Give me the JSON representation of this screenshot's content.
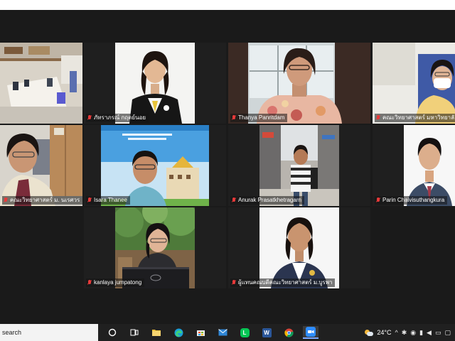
{
  "meeting": {
    "participants": [
      {
        "name": "",
        "tile": "conference-room"
      },
      {
        "name": "ภัทราภรณ์ กฤตย์นอย",
        "tile": "woman-white-bg"
      },
      {
        "name": "Thanya Panritdam",
        "tile": "woman-window"
      },
      {
        "name": "คณะวิทยาศาสตร์ มหาวิทยาลัยบูรพา",
        "tile": "woman-mask",
        "active": true
      },
      {
        "name": "คณะวิทยาศาสตร์ ม. นเรศวร",
        "tile": "man-office"
      },
      {
        "name": "Isara Thanee",
        "tile": "man-virtual-bg"
      },
      {
        "name": "Anurak Prasatkhetragarn",
        "tile": "man-street"
      },
      {
        "name": "Parin Chaivisuthangkura",
        "tile": "man-suit"
      },
      {
        "name": "kanlaya jumpatong",
        "tile": "woman-laptop"
      },
      {
        "name": "ผู้แทนคณบดีคณะวิทยาศาสตร์ ม.บูรพา",
        "tile": "woman-uniform"
      }
    ]
  },
  "taskbar": {
    "search_label": "search",
    "icons": [
      "cortana-icon",
      "task-view-icon",
      "file-explorer-icon",
      "edge-icon",
      "store-icon",
      "mail-icon",
      "line-icon",
      "word-icon",
      "chrome-icon",
      "zoom-icon"
    ],
    "word_letter": "W",
    "line_letter": "L",
    "weather_temp": "24°C",
    "tray_chevron": "^"
  },
  "colors": {
    "active_speaker_border": "#c7de3a",
    "muted_mic": "#e83a3a",
    "zoom_blue": "#2d8cff"
  }
}
